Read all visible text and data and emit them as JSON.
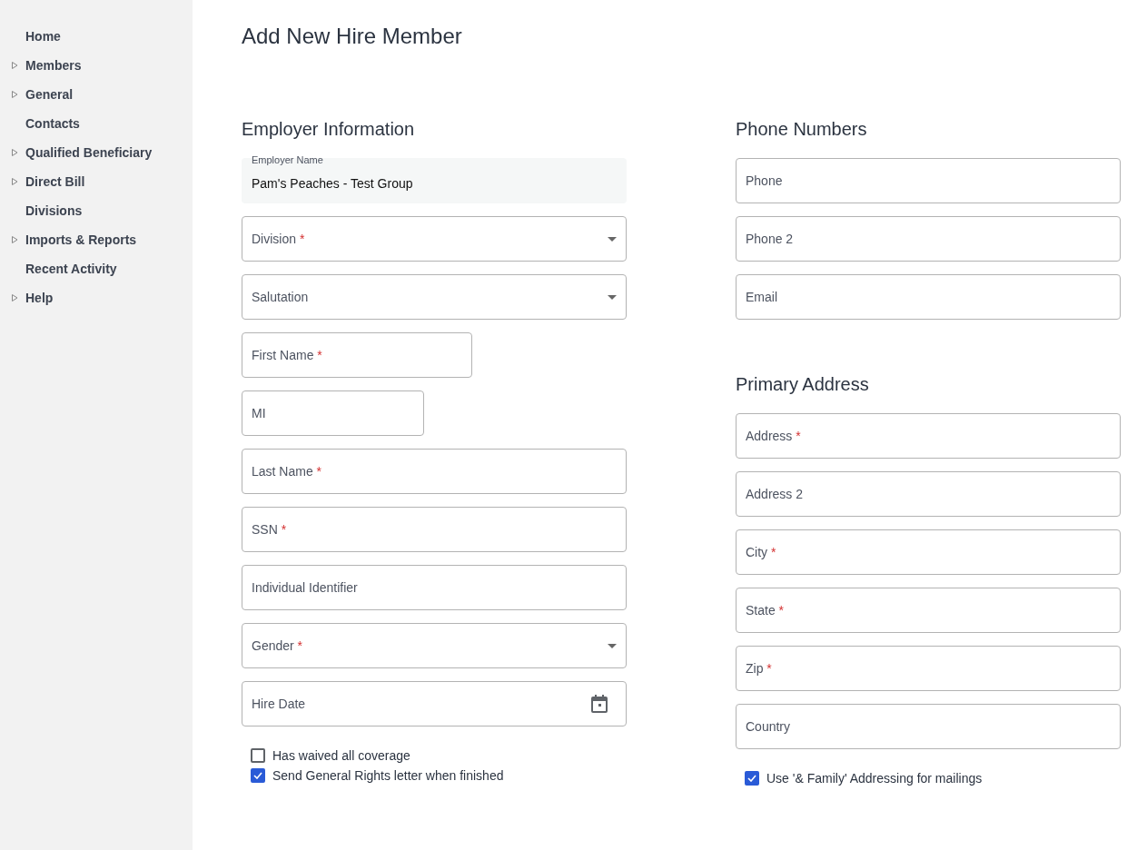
{
  "sidebar": {
    "items": [
      {
        "label": "Home",
        "expandable": false
      },
      {
        "label": "Members",
        "expandable": true
      },
      {
        "label": "General",
        "expandable": true
      },
      {
        "label": "Contacts",
        "expandable": false
      },
      {
        "label": "Qualified Beneficiary",
        "expandable": true
      },
      {
        "label": "Direct Bill",
        "expandable": true
      },
      {
        "label": "Divisions",
        "expandable": false
      },
      {
        "label": "Imports & Reports",
        "expandable": true
      },
      {
        "label": "Recent Activity",
        "expandable": false
      },
      {
        "label": "Help",
        "expandable": true
      }
    ]
  },
  "page_title": "Add New Hire Member",
  "employer_section": {
    "heading": "Employer Information",
    "fields": [
      {
        "kind": "readonly",
        "label": "Employer Name",
        "value": "Pam's Peaches - Test Group"
      },
      {
        "kind": "select",
        "placeholder": "Division",
        "asterisk": "*"
      },
      {
        "kind": "select",
        "placeholder": "Salutation"
      },
      {
        "kind": "text",
        "placeholder": "First Name",
        "asterisk": "*"
      },
      {
        "kind": "text",
        "placeholder": "MI"
      },
      {
        "kind": "text",
        "placeholder": "Last Name",
        "asterisk": "*"
      },
      {
        "kind": "text",
        "placeholder": "SSN",
        "asterisk": "*"
      },
      {
        "kind": "text",
        "placeholder": "Individual Identifier"
      },
      {
        "kind": "select",
        "placeholder": "Gender",
        "asterisk": "*"
      },
      {
        "kind": "date",
        "placeholder": "Hire Date"
      }
    ],
    "checkboxes": [
      {
        "label": "Has waived all coverage",
        "checked": false
      },
      {
        "label": "Send General Rights letter when finished",
        "checked": true
      }
    ]
  },
  "phone_section": {
    "heading": "Phone Numbers",
    "fields": [
      {
        "kind": "text",
        "placeholder": "Phone"
      },
      {
        "kind": "text",
        "placeholder": "Phone 2"
      },
      {
        "kind": "text",
        "placeholder": "Email"
      }
    ]
  },
  "address_section": {
    "heading": "Primary Address",
    "fields": [
      {
        "kind": "text",
        "placeholder": "Address",
        "asterisk": "*"
      },
      {
        "kind": "text",
        "placeholder": "Address 2"
      },
      {
        "kind": "text",
        "placeholder": "City",
        "asterisk": "*"
      },
      {
        "kind": "text",
        "placeholder": "State",
        "asterisk": "*"
      },
      {
        "kind": "text",
        "placeholder": "Zip",
        "asterisk": "*"
      },
      {
        "kind": "text",
        "placeholder": "Country"
      }
    ],
    "checkboxes": [
      {
        "label": "Use '& Family' Addressing for mailings",
        "checked": true
      }
    ]
  }
}
